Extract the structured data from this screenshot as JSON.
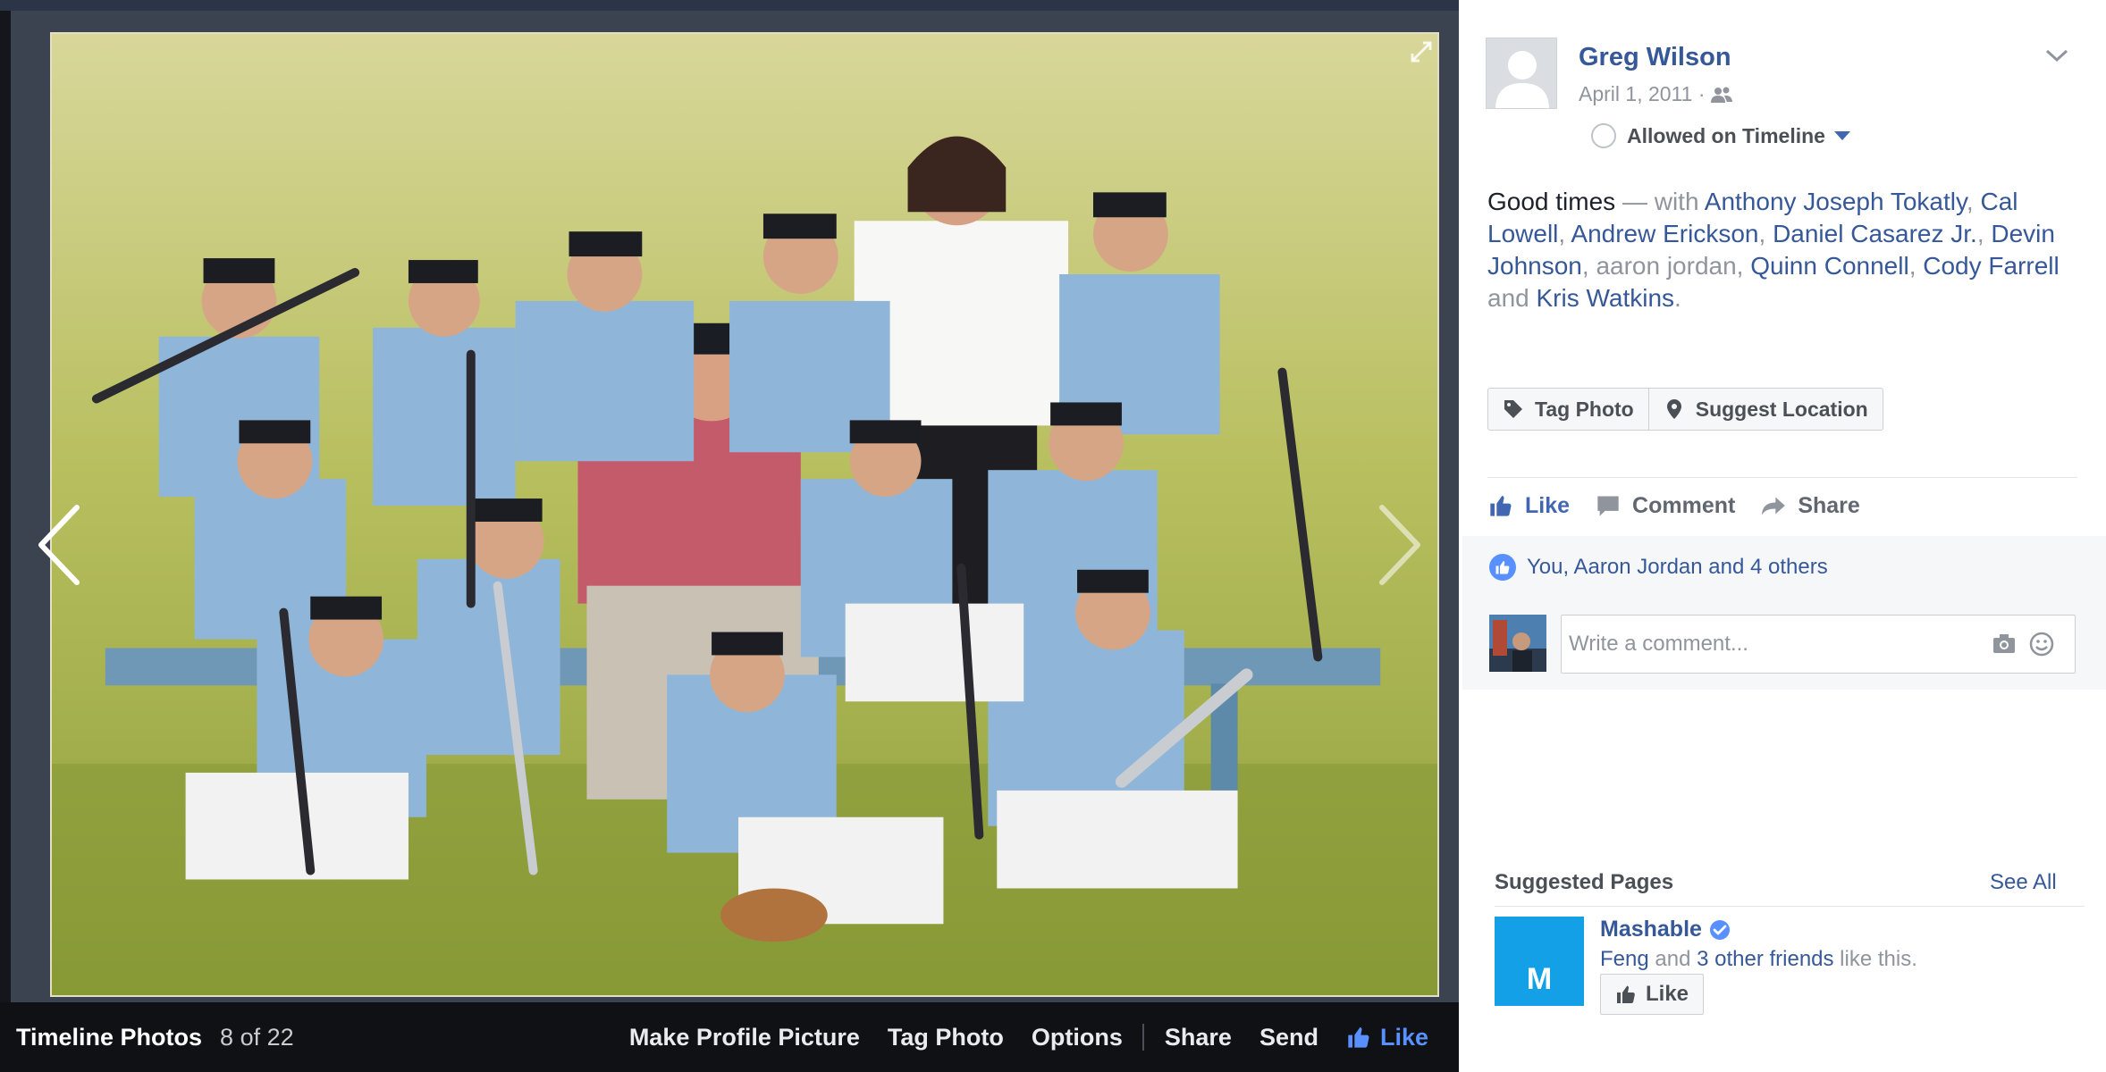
{
  "viewer": {
    "album_title": "Timeline Photos",
    "position_text": "8 of 22",
    "actions": {
      "make_profile_picture": "Make Profile Picture",
      "tag_photo": "Tag Photo",
      "options": "Options",
      "share": "Share",
      "send": "Send",
      "like": "Like"
    },
    "icons": {
      "prev": "chevron-left-icon",
      "next": "chevron-right-icon",
      "expand": "expand-icon"
    }
  },
  "post": {
    "author": "Greg Wilson",
    "date": "April 1, 2011 ·",
    "audience_icon": "friends-icon",
    "timeline_status": "Allowed on Timeline",
    "caption_text": "Good times",
    "caption_with": " — with ",
    "tagged": [
      {
        "name": "Anthony Joseph Tokatly",
        "linked": true,
        "after": ", "
      },
      {
        "name": "Cal Lowell",
        "linked": true,
        "after": ", "
      },
      {
        "name": "Andrew Erickson",
        "linked": true,
        "after": ", "
      },
      {
        "name": "Daniel Casarez Jr.",
        "linked": true,
        "after": ", "
      },
      {
        "name": "Devin Johnson",
        "linked": true,
        "after": ", "
      },
      {
        "name": "aaron jordan",
        "linked": false,
        "after": ", "
      },
      {
        "name": "Quinn Connell",
        "linked": true,
        "after": ", "
      },
      {
        "name": "Cody Farrell",
        "linked": true,
        "after": " and "
      },
      {
        "name": "Kris Watkins",
        "linked": true,
        "after": "."
      }
    ],
    "buttons": {
      "tag_photo": "Tag Photo",
      "suggest_location": "Suggest Location"
    },
    "reactions": {
      "like": "Like",
      "comment": "Comment",
      "share": "Share"
    },
    "likes_summary": "You, Aaron Jordan and 4 others",
    "comment_placeholder": "Write a comment..."
  },
  "suggested": {
    "heading": "Suggested Pages",
    "see_all": "See All",
    "page": {
      "name": "Mashable",
      "logo_letter": "M",
      "friend": "Feng",
      "and": " and ",
      "others": "3 other friends",
      "suffix": " like this.",
      "like_button": "Like"
    }
  },
  "colors": {
    "link": "#365899",
    "like_blue": "#4267b2",
    "viewer_bg": "#14161b",
    "mashable_blue": "#14a0e6"
  }
}
